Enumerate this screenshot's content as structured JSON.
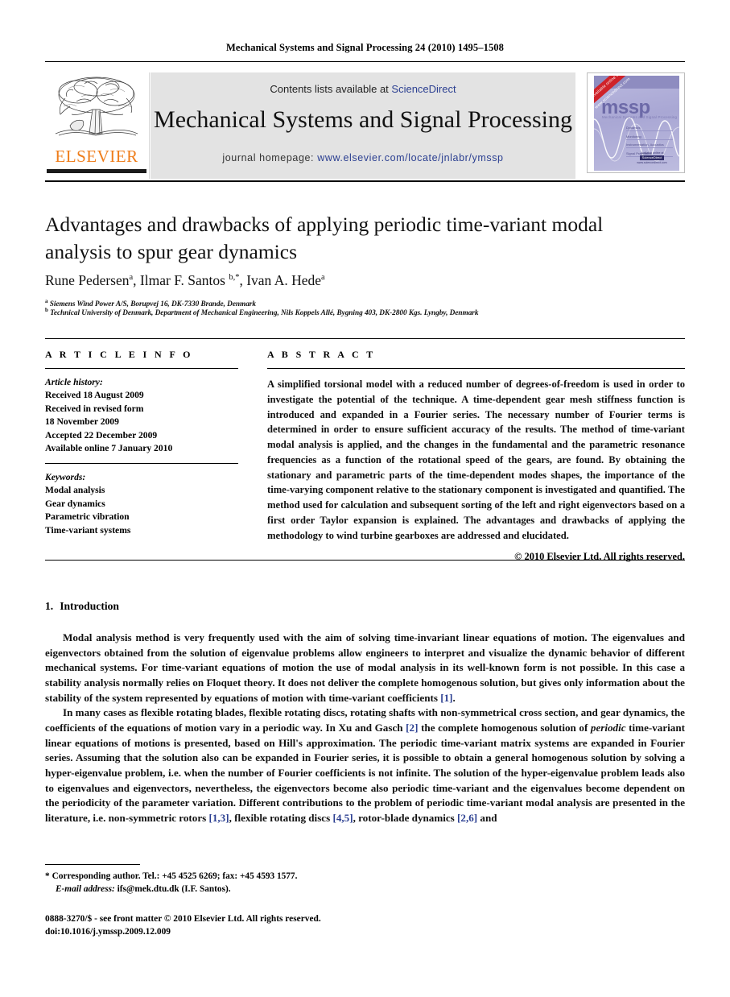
{
  "running_head": "Mechanical Systems and Signal Processing 24 (2010) 1495–1508",
  "masthead": {
    "publisher_logo_text": "ELSEVIER",
    "contents_prefix": "Contents lists available at ",
    "contents_link": "ScienceDirect",
    "journal_title": "Mechanical Systems and Signal Processing",
    "homepage_prefix": "journal homepage: ",
    "homepage_url": "www.elsevier.com/locate/jnlabr/ymssp",
    "cover": {
      "ribbon": "Available online at www.sciencedirect.com",
      "acronym": "mssp",
      "subtitle": "Mechanical Systems and Signal Processing",
      "toc_lines": [
        "Dynamics",
        "Monitoring",
        "Instrumentation, Acoustics",
        "Signal Processing"
      ],
      "badge_top": "Available online at",
      "badge_chip": "ScienceDirect",
      "badge_bottom": "www.sciencedirect.com"
    }
  },
  "article": {
    "title": "Advantages and drawbacks of applying periodic time-variant modal analysis to spur gear dynamics",
    "authors": [
      {
        "name": "Rune Pedersen",
        "marks": "a"
      },
      {
        "name": "Ilmar F. Santos",
        "marks": "b,*"
      },
      {
        "name": "Ivan A. Hede",
        "marks": "a"
      }
    ],
    "authors_line": "Rune Pedersen a, Ilmar F. Santos b,*, Ivan A. Hede a",
    "affiliations": [
      {
        "mark": "a",
        "text": "Siemens Wind Power A/S, Borupvej 16, DK-7330 Brande, Denmark"
      },
      {
        "mark": "b",
        "text": "Technical University of Denmark, Department of Mechanical Engineering, Nils Koppels Allé, Bygning 403, DK-2800 Kgs. Lyngby, Denmark"
      }
    ]
  },
  "article_info": {
    "heading": "A R T I C L E  I N F O",
    "history_label": "Article history:",
    "history": [
      "Received 18 August 2009",
      "Received in revised form",
      "18 November 2009",
      "Accepted 22 December 2009",
      "Available online 7 January 2010"
    ],
    "keywords_label": "Keywords:",
    "keywords": [
      "Modal analysis",
      "Gear dynamics",
      "Parametric vibration",
      "Time-variant systems"
    ]
  },
  "abstract": {
    "heading": "A B S T R A C T",
    "text": "A simplified torsional model with a reduced number of degrees-of-freedom is used in order to investigate the potential of the technique. A time-dependent gear mesh stiffness function is introduced and expanded in a Fourier series. The necessary number of Fourier terms is determined in order to ensure sufficient accuracy of the results. The method of time-variant modal analysis is applied, and the changes in the fundamental and the parametric resonance frequencies as a function of the rotational speed of the gears, are found. By obtaining the stationary and parametric parts of the time-dependent modes shapes, the importance of the time-varying component relative to the stationary component is investigated and quantified. The method used for calculation and subsequent sorting of the left and right eigenvectors based on a first order Taylor expansion is explained. The advantages and drawbacks of applying the methodology to wind turbine gearboxes are addressed and elucidated.",
    "copyright": "© 2010 Elsevier Ltd. All rights reserved."
  },
  "section": {
    "number": "1.",
    "title": "Introduction",
    "paragraph_1_a": "Modal analysis method is very frequently used with the aim of solving time-invariant linear equations of motion. The eigenvalues and eigenvectors obtained from the solution of eigenvalue problems allow engineers to interpret and visualize the dynamic behavior of different mechanical systems. For time-variant equations of motion the use of modal analysis in its well-known form is not possible. In this case a stability analysis normally relies on Floquet theory. It does not deliver the complete homogenous solution, but gives only information about the stability of the system represented by equations of motion with time-variant coefficients ",
    "paragraph_1_ref": "[1]",
    "paragraph_1_b": ".",
    "paragraph_2_a": "In many cases as flexible rotating blades, flexible rotating discs, rotating shafts with non-symmetrical cross section, and gear dynamics, the coefficients of the equations of motion vary in a periodic way. In Xu and Gasch ",
    "paragraph_2_ref1": "[2]",
    "paragraph_2_b": " the complete homogenous solution of ",
    "paragraph_2_italic": "periodic",
    "paragraph_2_c": " time-variant linear equations of motions is presented, based on Hill's approximation. The periodic time-variant matrix systems are expanded in Fourier series. Assuming that the solution also can be expanded in Fourier series, it is possible to obtain a general homogenous solution by solving a hyper-eigenvalue problem, i.e. when the number of Fourier coefficients is not infinite. The solution of the hyper-eigenvalue problem leads also to eigenvalues and eigenvectors, nevertheless, the eigenvectors become also periodic time-variant and the eigenvalues become dependent on the periodicity of the parameter variation. Different contributions to the problem of periodic time-variant modal analysis are presented in the literature, i.e. non-symmetric rotors ",
    "paragraph_2_ref2": "[1,3]",
    "paragraph_2_d": ", flexible rotating discs ",
    "paragraph_2_ref3": "[4,5]",
    "paragraph_2_e": ", rotor-blade dynamics ",
    "paragraph_2_ref4": "[2,6]",
    "paragraph_2_f": " and"
  },
  "footnotes": {
    "star": "*",
    "corresponding": "Corresponding author. Tel.: +45 4525 6269; fax: +45 4593 1577.",
    "email_label": "E-mail address:",
    "email": "ifs@mek.dtu.dk (I.F. Santos).",
    "issn_line": "0888-3270/$ - see front matter © 2010 Elsevier Ltd. All rights reserved.",
    "doi_line": "doi:10.1016/j.ymssp.2009.12.009"
  },
  "colors": {
    "link": "#2b3f91",
    "elsevier_orange": "#ef7d1a",
    "banner_bg": "#e3e3e3",
    "cover_purple": "#b9b8de",
    "ribbon_red": "#cf2229"
  }
}
